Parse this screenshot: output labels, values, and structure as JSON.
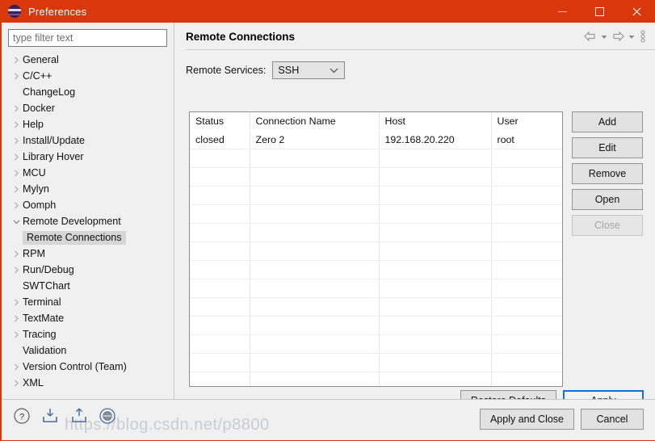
{
  "window": {
    "title": "Preferences",
    "icon": "eclipse-icon",
    "controls": {
      "minimize": "minimize-icon",
      "maximize": "maximize-icon",
      "close": "close-icon"
    }
  },
  "sidebar": {
    "filter": {
      "placeholder": "type filter text",
      "value": ""
    },
    "items": [
      {
        "label": "General",
        "expandable": true,
        "expanded": false,
        "selected": false,
        "child": false
      },
      {
        "label": "C/C++",
        "expandable": true,
        "expanded": false,
        "selected": false,
        "child": false
      },
      {
        "label": "ChangeLog",
        "expandable": false,
        "expanded": false,
        "selected": false,
        "child": false
      },
      {
        "label": "Docker",
        "expandable": true,
        "expanded": false,
        "selected": false,
        "child": false
      },
      {
        "label": "Help",
        "expandable": true,
        "expanded": false,
        "selected": false,
        "child": false
      },
      {
        "label": "Install/Update",
        "expandable": true,
        "expanded": false,
        "selected": false,
        "child": false
      },
      {
        "label": "Library Hover",
        "expandable": true,
        "expanded": false,
        "selected": false,
        "child": false
      },
      {
        "label": "MCU",
        "expandable": true,
        "expanded": false,
        "selected": false,
        "child": false
      },
      {
        "label": "Mylyn",
        "expandable": true,
        "expanded": false,
        "selected": false,
        "child": false
      },
      {
        "label": "Oomph",
        "expandable": true,
        "expanded": false,
        "selected": false,
        "child": false
      },
      {
        "label": "Remote Development",
        "expandable": true,
        "expanded": true,
        "selected": false,
        "child": false
      },
      {
        "label": "Remote Connections",
        "expandable": false,
        "expanded": false,
        "selected": true,
        "child": true
      },
      {
        "label": "RPM",
        "expandable": true,
        "expanded": false,
        "selected": false,
        "child": false
      },
      {
        "label": "Run/Debug",
        "expandable": true,
        "expanded": false,
        "selected": false,
        "child": false
      },
      {
        "label": "SWTChart",
        "expandable": false,
        "expanded": false,
        "selected": false,
        "child": false
      },
      {
        "label": "Terminal",
        "expandable": true,
        "expanded": false,
        "selected": false,
        "child": false
      },
      {
        "label": "TextMate",
        "expandable": true,
        "expanded": false,
        "selected": false,
        "child": false
      },
      {
        "label": "Tracing",
        "expandable": true,
        "expanded": false,
        "selected": false,
        "child": false
      },
      {
        "label": "Validation",
        "expandable": false,
        "expanded": false,
        "selected": false,
        "child": false
      },
      {
        "label": "Version Control (Team)",
        "expandable": true,
        "expanded": false,
        "selected": false,
        "child": false
      },
      {
        "label": "XML",
        "expandable": true,
        "expanded": false,
        "selected": false,
        "child": false
      }
    ]
  },
  "page": {
    "title": "Remote Connections",
    "header_tools": [
      "back-icon",
      "back-dropdown-icon",
      "forward-icon",
      "forward-dropdown-icon",
      "view-menu-icon"
    ],
    "service": {
      "label": "Remote Services:",
      "value": "SSH",
      "options": [
        "SSH"
      ]
    },
    "table": {
      "columns": [
        "Status",
        "Connection Name",
        "Host",
        "User"
      ],
      "rows": [
        [
          "closed",
          "Zero 2",
          "192.168.20.220",
          "root"
        ]
      ],
      "empty_rows": 14
    },
    "side_buttons": [
      {
        "label": "Add",
        "enabled": true
      },
      {
        "label": "Edit",
        "enabled": true
      },
      {
        "label": "Remove",
        "enabled": true
      },
      {
        "label": "Open",
        "enabled": true
      },
      {
        "label": "Close",
        "enabled": false
      }
    ],
    "restore_defaults_label": "Restore Defaults",
    "apply_label": "Apply"
  },
  "footer": {
    "icons": [
      "help-icon",
      "import-icon",
      "export-icon",
      "target-icon"
    ],
    "apply_and_close_label": "Apply and Close",
    "cancel_label": "Cancel"
  },
  "watermark": "https://blog.csdn.net/p8800",
  "colors": {
    "titlebar": "#d8380c",
    "panel": "#f0f0f0",
    "accent": "#0a74d8",
    "selection": "#d6d6d6"
  }
}
